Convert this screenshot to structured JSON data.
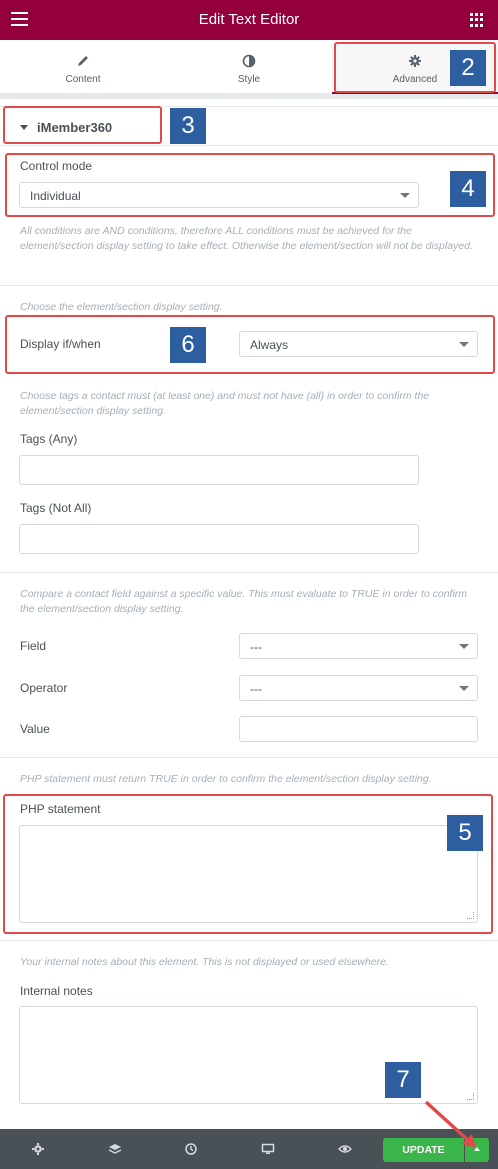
{
  "header": {
    "title": "Edit Text Editor",
    "menu_icon": "hamburger-icon",
    "apps_icon": "grid-icon"
  },
  "tabs": [
    {
      "label": "Content",
      "icon": "pencil-icon"
    },
    {
      "label": "Style",
      "icon": "half-circle-icon"
    },
    {
      "label": "Advanced",
      "icon": "gear-icon"
    }
  ],
  "section": {
    "title": "iMember360"
  },
  "control_mode": {
    "label": "Control mode",
    "value": "Individual",
    "description": "All conditions are AND conditions, therefore ALL conditions must be achieved for the element/section display setting to take effect. Otherwise the element/section will not be displayed."
  },
  "display": {
    "description": "Choose the element/section display setting.",
    "label": "Display if/when",
    "value": "Always"
  },
  "tags": {
    "description": "Choose tags a contact must (at least one) and must not have (all) in order to confirm the element/section display setting.",
    "any_label": "Tags (Any)",
    "not_all_label": "Tags (Not All)"
  },
  "field_compare": {
    "description": "Compare a contact field against a specific value. This must evaluate to TRUE in order to confirm the element/section display setting.",
    "field_label": "Field",
    "field_value": "---",
    "operator_label": "Operator",
    "operator_value": "---",
    "value_label": "Value"
  },
  "php": {
    "description": "PHP statement must return TRUE in order to confirm the element/section display setting.",
    "label": "PHP statement"
  },
  "notes": {
    "description": "Your internal notes about this element. This is not displayed or used elsewhere.",
    "label": "Internal notes"
  },
  "footer": {
    "update_label": "UPDATE",
    "icons": [
      "gear-icon",
      "layers-icon",
      "history-icon",
      "desktop-icon",
      "eye-icon"
    ]
  },
  "annotations": {
    "badge_2": "2",
    "badge_3": "3",
    "badge_4": "4",
    "badge_5": "5",
    "badge_6": "6",
    "badge_7": "7"
  },
  "colors": {
    "brand": "#93003c",
    "highlight": "#e24949",
    "badge": "#2c5ea0",
    "update": "#39b54a",
    "footer": "#495157"
  }
}
